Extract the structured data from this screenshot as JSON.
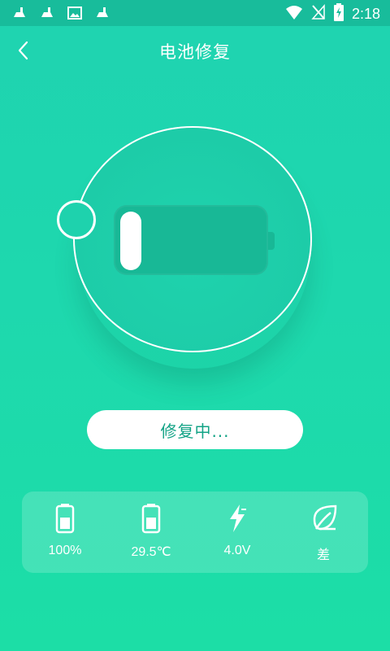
{
  "status_bar": {
    "time": "2:18",
    "left_icons": [
      "notification-broom-icon",
      "notification-broom-icon",
      "image-icon",
      "notification-broom-icon"
    ],
    "right_icons": [
      "wifi-icon",
      "no-signal-icon",
      "battery-charging-icon"
    ]
  },
  "header": {
    "title": "电池修复",
    "back_icon": "chevron-left-icon"
  },
  "battery": {
    "ring_color": "#ffffff",
    "body_color": "#18b896"
  },
  "action_button": {
    "label": "修复中..."
  },
  "stats": [
    {
      "icon": "battery-icon",
      "label": "100%"
    },
    {
      "icon": "battery-icon",
      "label": "29.5℃"
    },
    {
      "icon": "lightning-icon",
      "label": "4.0V"
    },
    {
      "icon": "leaf-icon",
      "label": "差"
    }
  ],
  "colors": {
    "background": "#1ed8ae",
    "status_bar": "#18bc9b",
    "accent_text": "#13a386"
  }
}
